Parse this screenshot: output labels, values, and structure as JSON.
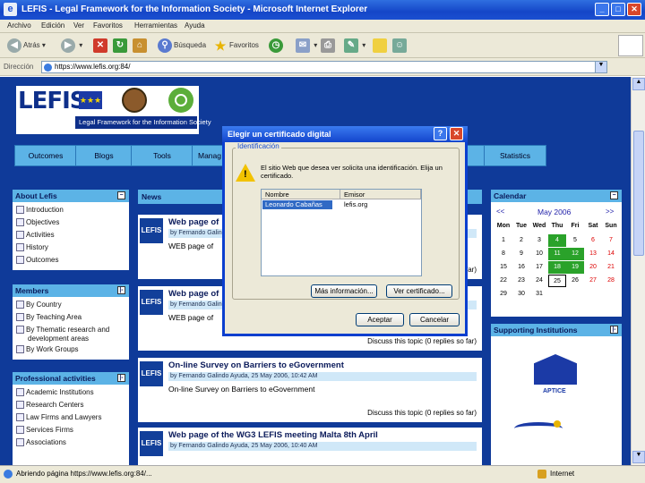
{
  "window": {
    "title": "LEFIS - Legal Framework for the Information Society - Microsoft Internet Explorer",
    "minimize": "_",
    "maximize": "□",
    "close": "✕"
  },
  "menu": [
    "Archivo",
    "Edición",
    "Ver",
    "Favoritos",
    "Herramientas",
    "Ayuda"
  ],
  "toolbar": {
    "back": "Atrás",
    "search": "Búsqueda",
    "favorites": "Favoritos"
  },
  "address": {
    "label": "Dirección",
    "url": "https://www.lefis.org:84/"
  },
  "site": {
    "logo_text": "LEFIS",
    "logo_subtitle": "Legal Framework for the Information Society",
    "nav": [
      "Outcomes",
      "Blogs",
      "Tools",
      "Manag",
      "Statistics"
    ],
    "about": {
      "title": "About Lefis",
      "toggle": "−",
      "items": [
        "Introduction",
        "Objectives",
        "Activities",
        "History",
        "Outcomes"
      ]
    },
    "members": {
      "title": "Members",
      "toggle": "|-",
      "items": [
        "By Country",
        "By Teaching Area",
        "By Thematic research and",
        "development areas",
        "By Work Groups"
      ]
    },
    "professional": {
      "title": "Professional activities",
      "toggle": "|-",
      "items": [
        "Academic Institutions",
        "Research Centers",
        "Law Firms and Lawyers",
        "Services Firms",
        "Associations"
      ]
    },
    "news": {
      "title": "News"
    },
    "posts": [
      {
        "title": "Web page of",
        "by": "by Fernando Galindo Ayuda",
        "body": "WEB page of",
        "footer": ""
      },
      {
        "title": "Web page of",
        "by": "by Fernando Galindo Ayuda",
        "body": "WEB page of",
        "footer": "Discuss this topic (0 replies so far)"
      },
      {
        "title": "On-line Survey on Barriers to eGovernment",
        "by": "by Fernando Galindo Ayuda, 25 May 2006, 10:42 AM",
        "body": "On-line Survey on Barriers to eGovernment",
        "footer": "Discuss this topic (0 replies so far)"
      },
      {
        "title": "Web page of the WG3 LEFIS meeting Malta 8th April",
        "by": "by Fernando Galindo Ayuda, 25 May 2006, 10:40 AM",
        "body": "",
        "footer": ""
      }
    ],
    "calendar": {
      "title": "Calendar",
      "toggle": "−",
      "prev": "<<",
      "month": "May 2006",
      "next": ">>",
      "days": [
        "Mon",
        "Tue",
        "Wed",
        "Thu",
        "Fri",
        "Sat",
        "Sun"
      ],
      "weeks": [
        [
          "1",
          "2",
          "3",
          "4",
          "5",
          "6",
          "7"
        ],
        [
          "8",
          "9",
          "10",
          "11",
          "12",
          "13",
          "14"
        ],
        [
          "15",
          "16",
          "17",
          "18",
          "19",
          "20",
          "21"
        ],
        [
          "22",
          "23",
          "24",
          "25",
          "26",
          "27",
          "28"
        ],
        [
          "29",
          "30",
          "31",
          "",
          "",
          "",
          ""
        ]
      ]
    },
    "supporting": {
      "title": "Supporting Institutions",
      "toggle": "|-",
      "aptice": "APTICE"
    }
  },
  "dialog": {
    "title": "Elegir un certificado digital",
    "help": "?",
    "close": "✕",
    "group": "Identificación",
    "message": "El sitio Web que desea ver solicita una identificación. Elija un certificado.",
    "col_name": "Nombre",
    "col_issuer": "Emisor",
    "cert_name": "Leonardo Cabañas",
    "cert_issuer": "lefis.org",
    "more_info": "Más información...",
    "view_cert": "Ver certificado...",
    "accept": "Aceptar",
    "cancel": "Cancelar"
  },
  "status": {
    "text": "Abriendo página https://www.lefis.org:84/...",
    "zone": "Internet"
  }
}
